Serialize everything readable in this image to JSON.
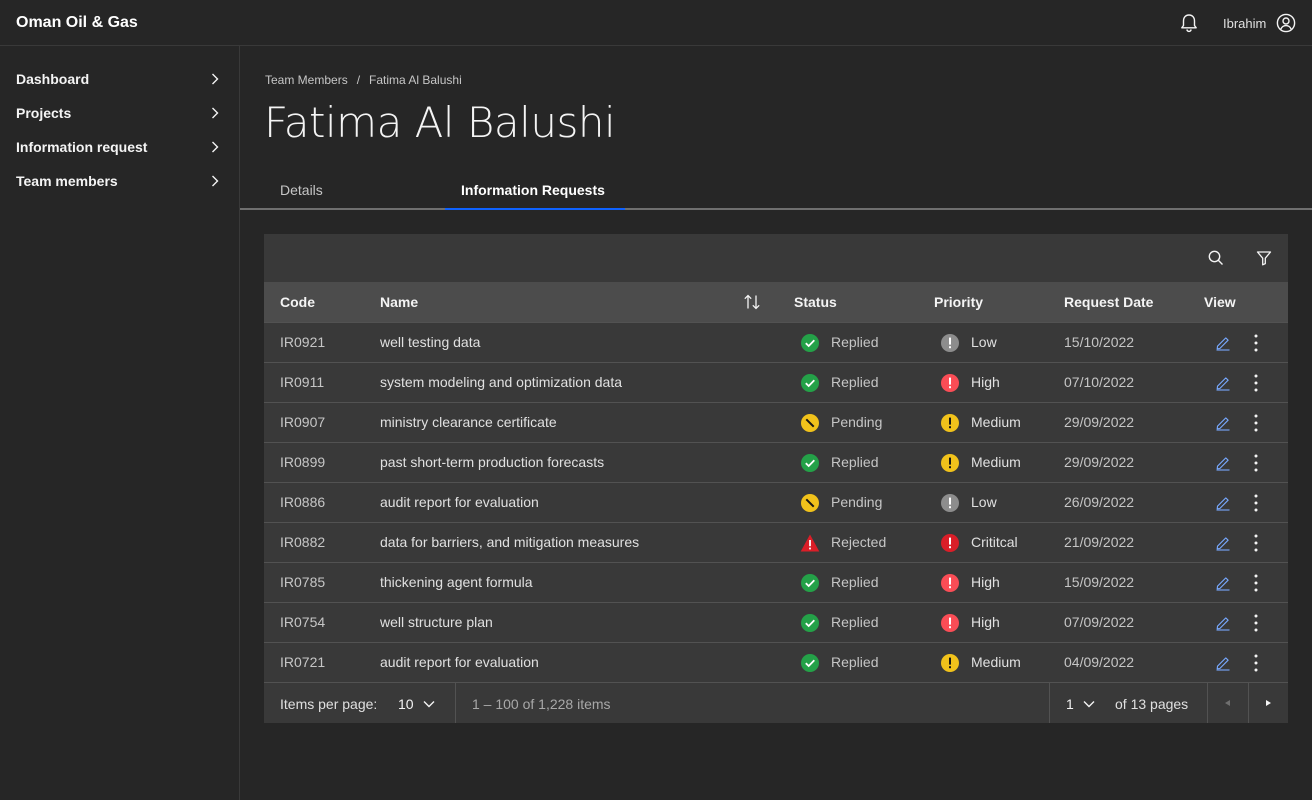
{
  "app": {
    "title": "Oman Oil & Gas"
  },
  "header": {
    "user_name": "Ibrahim",
    "notification_icon": "bell-icon",
    "user_icon": "user-avatar-icon"
  },
  "sidebar": {
    "items": [
      {
        "label": "Dashboard"
      },
      {
        "label": "Projects"
      },
      {
        "label": "Information request"
      },
      {
        "label": "Team members"
      }
    ]
  },
  "breadcrumb": {
    "parent": "Team Members",
    "separator": "/",
    "current": "Fatima Al Balushi"
  },
  "page": {
    "title": "Fatima Al Balushi"
  },
  "tabs": [
    {
      "label": "Details",
      "selected": false
    },
    {
      "label": "Information Requests",
      "selected": true
    }
  ],
  "table": {
    "headers": {
      "code": "Code",
      "name": "Name",
      "status": "Status",
      "priority": "Priority",
      "date": "Request Date",
      "view": "View"
    },
    "rows": [
      {
        "code": "IR0921",
        "name": "well testing data",
        "status": "Replied",
        "status_kind": "replied",
        "priority": "Low",
        "priority_kind": "low",
        "date": "15/10/2022"
      },
      {
        "code": "IR0911",
        "name": "system modeling and optimization data",
        "status": "Replied",
        "status_kind": "replied",
        "priority": "High",
        "priority_kind": "high",
        "date": "07/10/2022"
      },
      {
        "code": "IR0907",
        "name": "ministry clearance certificate",
        "status": "Pending",
        "status_kind": "pending",
        "priority": "Medium",
        "priority_kind": "medium",
        "date": "29/09/2022"
      },
      {
        "code": "IR0899",
        "name": "past short-term production forecasts",
        "status": "Replied",
        "status_kind": "replied",
        "priority": "Medium",
        "priority_kind": "medium",
        "date": "29/09/2022"
      },
      {
        "code": "IR0886",
        "name": "audit report for evaluation",
        "status": "Pending",
        "status_kind": "pending",
        "priority": "Low",
        "priority_kind": "low",
        "date": "26/09/2022"
      },
      {
        "code": "IR0882",
        "name": "data for barriers, and mitigation measures",
        "status": "Rejected",
        "status_kind": "rejected",
        "priority": "Crititcal",
        "priority_kind": "critical",
        "date": "21/09/2022"
      },
      {
        "code": "IR0785",
        "name": "thickening agent formula",
        "status": "Replied",
        "status_kind": "replied",
        "priority": "High",
        "priority_kind": "high",
        "date": "15/09/2022"
      },
      {
        "code": "IR0754",
        "name": "well structure plan",
        "status": "Replied",
        "status_kind": "replied",
        "priority": "High",
        "priority_kind": "high",
        "date": "07/09/2022"
      },
      {
        "code": "IR0721",
        "name": "audit report for evaluation",
        "status": "Replied",
        "status_kind": "replied",
        "priority": "Medium",
        "priority_kind": "medium",
        "date": "04/09/2022"
      }
    ]
  },
  "pagination": {
    "items_per_page_label": "Items per page:",
    "items_per_page": "10",
    "range_text": "1 – 100 of 1,228 items",
    "current_page": "1",
    "of_pages_text": "of 13 pages"
  },
  "colors": {
    "replied": "#24a148",
    "pending": "#f1c21b",
    "rejected": "#da1e28",
    "low": "#8d8d8d",
    "medium": "#f1c21b",
    "high": "#fa4d56",
    "critical": "#da1e28",
    "tab_accent": "#0f62fe",
    "edit_link": "#78a9ff"
  }
}
